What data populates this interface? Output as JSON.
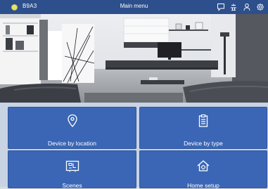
{
  "header": {
    "device_id": "B9A3",
    "title": "Main menu",
    "icons": [
      "chat-icon",
      "network-icon",
      "user-icon",
      "settings-icon"
    ],
    "accent": "#2d4f8c",
    "status_color": "#e9e266"
  },
  "tiles": [
    {
      "label": "Device by location",
      "icon": "location-pin-icon"
    },
    {
      "label": "Device by type",
      "icon": "clipboard-icon"
    },
    {
      "label": "Scenes",
      "icon": "scenes-icon"
    },
    {
      "label": "Home setup",
      "icon": "home-setup-icon"
    }
  ],
  "tile_color": "#3b66b5"
}
